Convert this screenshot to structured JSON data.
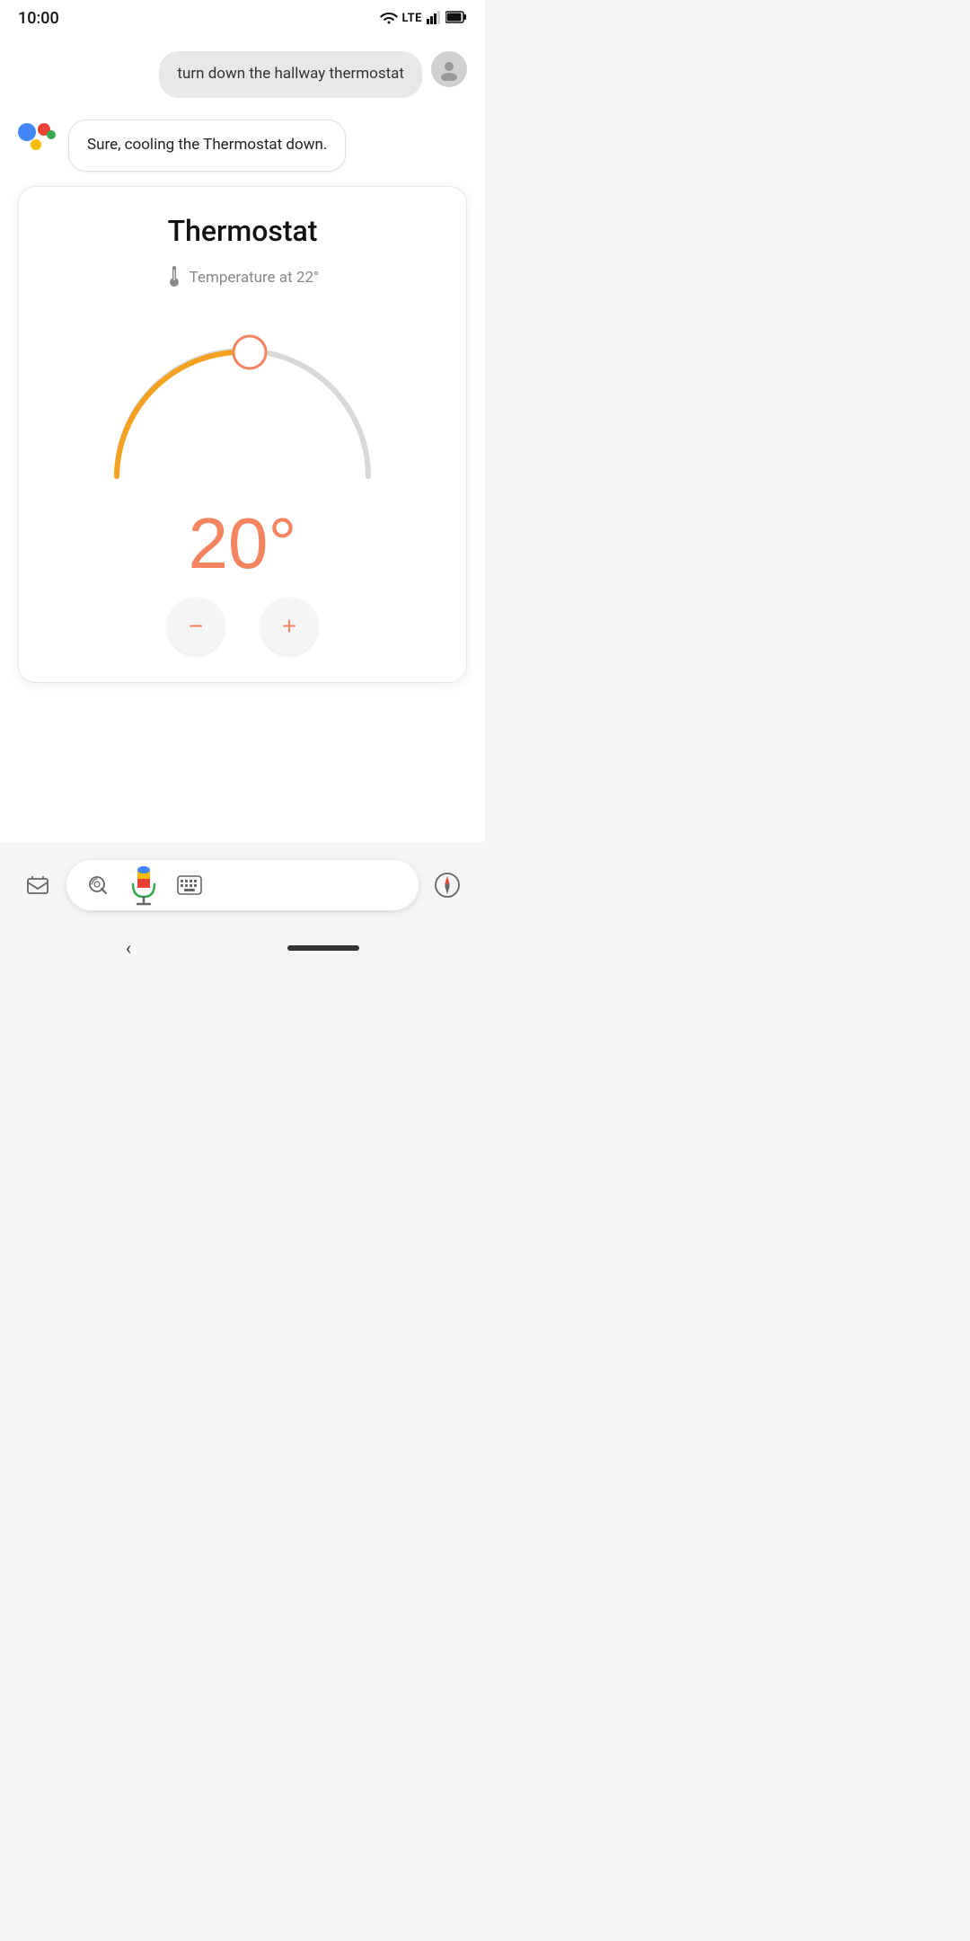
{
  "statusBar": {
    "time": "10:00",
    "lteLabel": "LTE"
  },
  "userMessage": {
    "text": "turn down the hallway thermostat"
  },
  "assistantMessage": {
    "text": "Sure, cooling the Thermostat down."
  },
  "thermostat": {
    "title": "Thermostat",
    "temperatureLabel": "Temperature at 22°",
    "currentTemp": "20°",
    "colors": {
      "arc": "#F4845F",
      "arcRemaining": "#d0d0d0",
      "handle": "#F4845F",
      "text": "#F4845F"
    },
    "decreaseLabel": "−",
    "increaseLabel": "+"
  },
  "bottomBar": {
    "lensAlt": "lens",
    "micAlt": "microphone",
    "keyboardAlt": "keyboard",
    "compassAlt": "compass",
    "inboxAlt": "inbox"
  }
}
